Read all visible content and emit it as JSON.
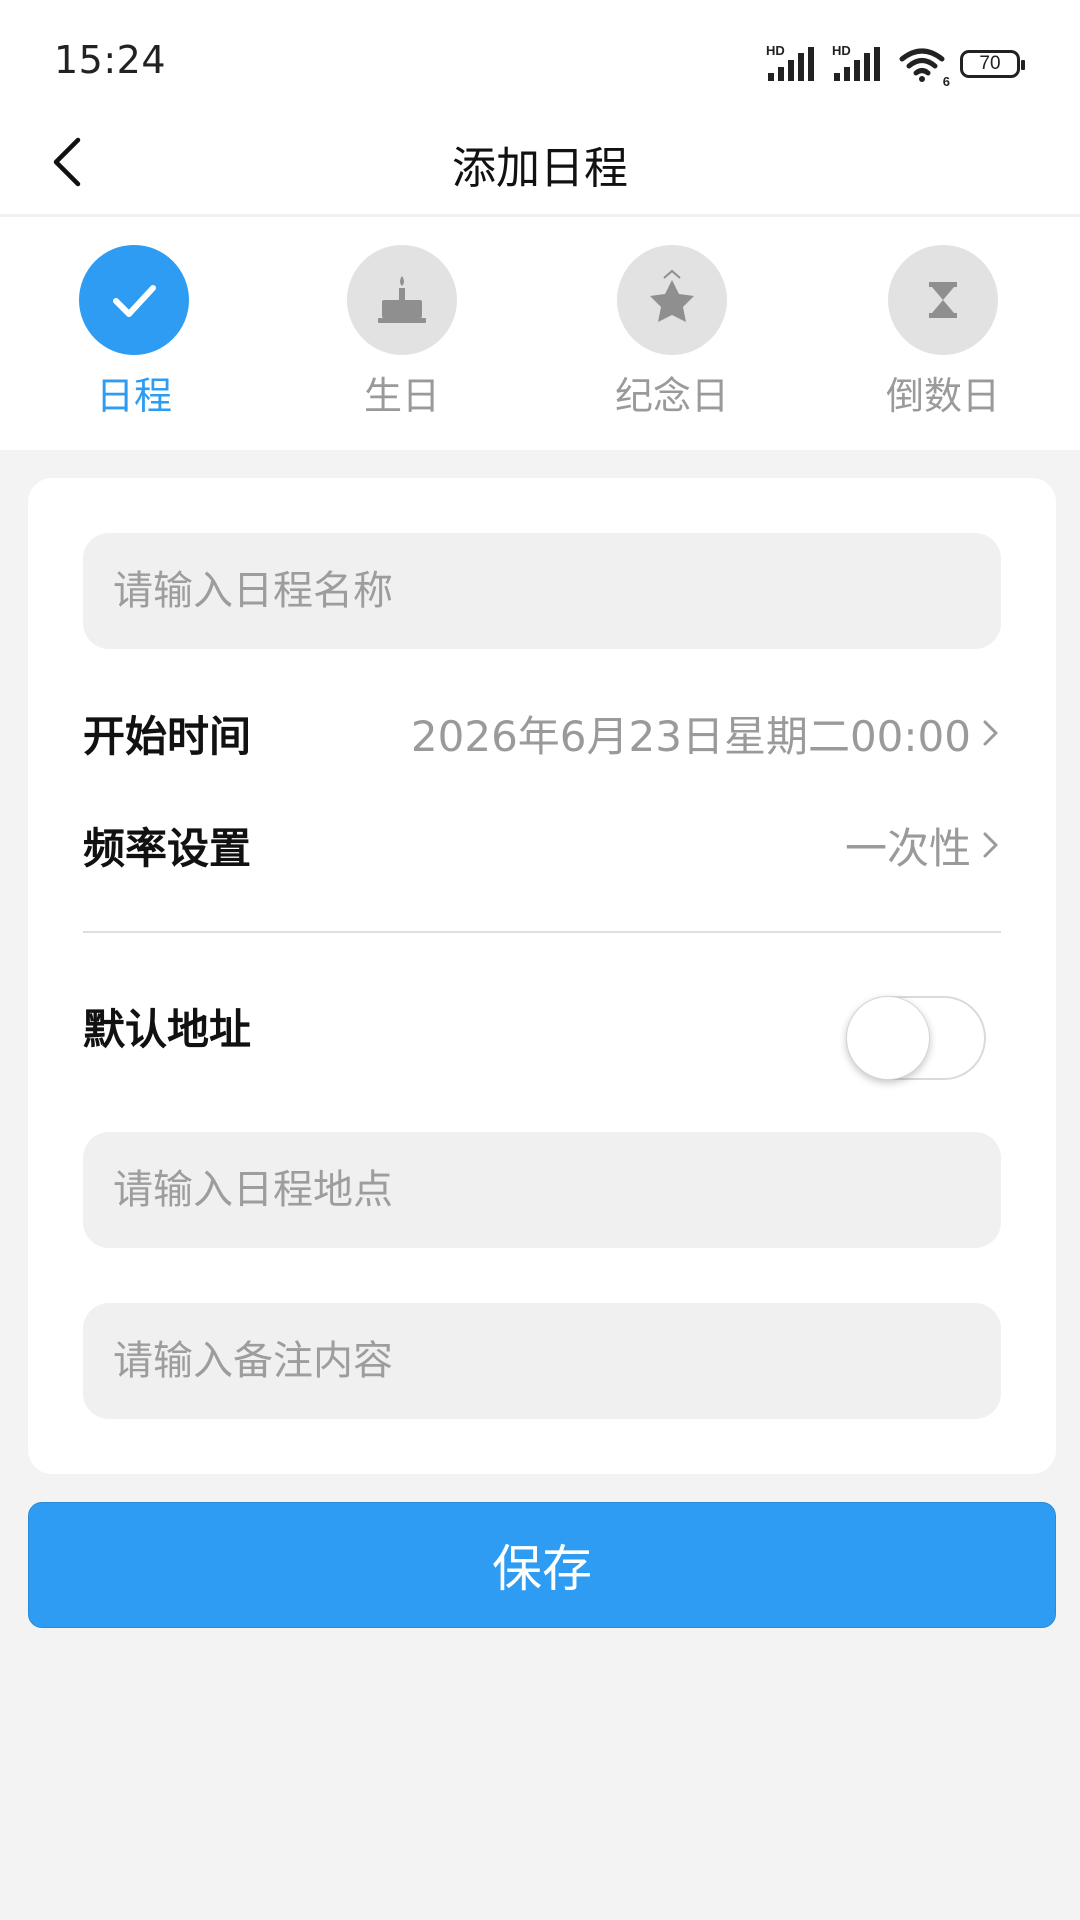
{
  "status_bar": {
    "time": "15:24",
    "signal1_label": "HD",
    "signal2_label": "HD",
    "wifi_label": "6",
    "battery_level": "70"
  },
  "header": {
    "title": "添加日程",
    "back_icon": "chevron-left-icon"
  },
  "types": [
    {
      "label": "日程",
      "icon": "check-icon",
      "active": true
    },
    {
      "label": "生日",
      "icon": "cake-icon",
      "active": false
    },
    {
      "label": "纪念日",
      "icon": "star-icon",
      "active": false
    },
    {
      "label": "倒数日",
      "icon": "hourglass-icon",
      "active": false
    }
  ],
  "form": {
    "name_placeholder": "请输入日程名称",
    "start_time_label": "开始时间",
    "start_time_value": "2026年6月23日星期二00:00",
    "frequency_label": "频率设置",
    "frequency_value": "一次性",
    "default_address_label": "默认地址",
    "default_address_enabled": false,
    "location_placeholder": "请输入日程地点",
    "note_placeholder": "请输入备注内容"
  },
  "actions": {
    "save_label": "保存"
  },
  "colors": {
    "accent": "#2e9cf2",
    "inactive_icon_bg": "#e2e2e2",
    "inactive_text": "#9a9a9a",
    "page_bg": "#f3f3f3"
  }
}
